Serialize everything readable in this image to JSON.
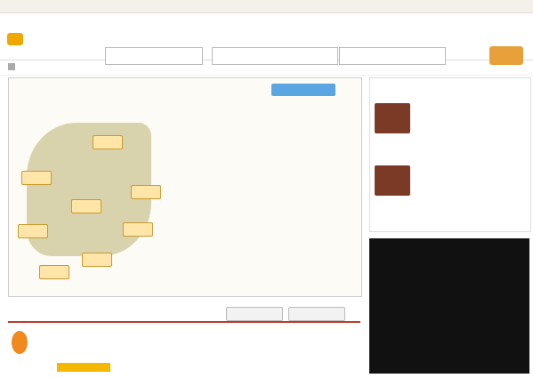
{
  "colors": {
    "brand": "#f0a800",
    "search_button": "#e8a13a",
    "map_land": "#d9d3ad",
    "region_tag": "#ffe6a8",
    "overseas_button": "#5aa6e0",
    "section_rule": "#c0392b"
  },
  "icons": [
    "logo-mark-icon",
    "home-icon",
    "star-icon"
  ]
}
